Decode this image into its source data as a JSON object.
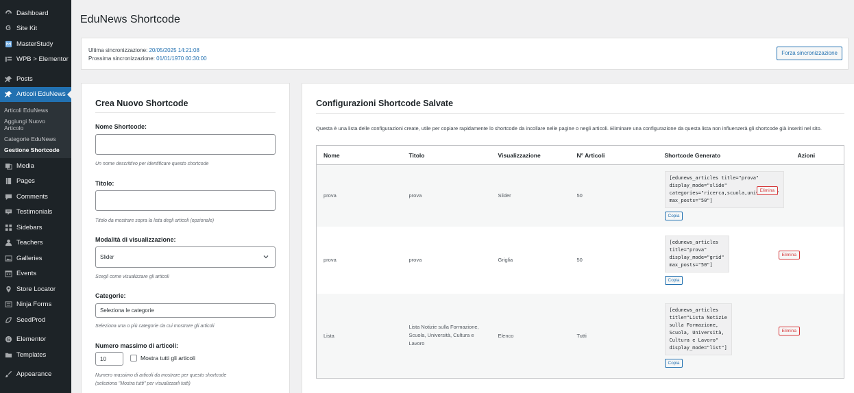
{
  "sidebar": {
    "items_top": [
      {
        "label": "Dashboard",
        "icon": "dashboard-icon"
      },
      {
        "label": "Site Kit",
        "icon": "sitekit-icon"
      },
      {
        "label": "MasterStudy",
        "icon": "masterstudy-icon"
      },
      {
        "label": "WPB > Elementor",
        "icon": "wpb-icon"
      },
      {
        "label": "Posts",
        "icon": "pin-icon"
      },
      {
        "label": "Articoli EduNews",
        "icon": "pin-icon"
      }
    ],
    "submenu": [
      "Articoli EduNews",
      "Aggiungi Nuovo Articolo",
      "Categorie EduNews",
      "Gestione Shortcode"
    ],
    "items_bottom": [
      {
        "label": "Media",
        "icon": "media-icon"
      },
      {
        "label": "Pages",
        "icon": "pages-icon"
      },
      {
        "label": "Comments",
        "icon": "comments-icon"
      },
      {
        "label": "Testimonials",
        "icon": "testimonials-icon"
      },
      {
        "label": "Sidebars",
        "icon": "sidebars-icon"
      },
      {
        "label": "Teachers",
        "icon": "teachers-icon"
      },
      {
        "label": "Galleries",
        "icon": "galleries-icon"
      },
      {
        "label": "Events",
        "icon": "calendar-icon"
      },
      {
        "label": "Store Locator",
        "icon": "location-icon"
      },
      {
        "label": "Ninja Forms",
        "icon": "forms-icon"
      },
      {
        "label": "SeedProd",
        "icon": "seedprod-icon"
      },
      {
        "label": "Elementor",
        "icon": "elementor-icon"
      },
      {
        "label": "Templates",
        "icon": "folder-icon"
      },
      {
        "label": "Appearance",
        "icon": "brush-icon"
      }
    ]
  },
  "page": {
    "title": "EduNews Shortcode"
  },
  "sync": {
    "last_label": "Ultima sincronizzazione: ",
    "last_value": "20/05/2025 14:21:08",
    "next_label": "Prossima sincronizzazione: ",
    "next_value": "01/01/1970 00:30:00",
    "force_button": "Forza sincronizzazione"
  },
  "form": {
    "title": "Crea Nuovo Shortcode",
    "name_label": "Nome Shortcode:",
    "name_value": "",
    "name_help": "Un nome descrittivo per identificare questo shortcode",
    "title_label": "Titolo:",
    "title_value": "",
    "title_help": "Titolo da mostrare sopra la lista degli articoli (opzionale)",
    "mode_label": "Modalità di visualizzazione:",
    "mode_value": "Slider",
    "mode_help": "Scegli come visualizzare gli articoli",
    "cat_label": "Categorie:",
    "cat_placeholder": "Seleziona le categorie",
    "cat_help": "Seleziona una o più categorie da cui mostrare gli articoli",
    "max_label": "Numero massimo di articoli:",
    "max_value": "10",
    "show_all_label": "Mostra tutti gli articoli",
    "max_help_1": "Numero massimo di articoli da mostrare per questo shortcode",
    "max_help_2": "(seleziona \"Mostra tutti\" per visualizzarli tutti)"
  },
  "saved": {
    "title": "Configurazioni Shortcode Salvate",
    "intro": "Questa è una lista delle configurazioni create, utile per copiare rapidamente lo shortcode da incollare nelle pagine o negli articoli. Eliminare una configurazione da questa lista non influenzerà gli shortcode già inseriti nel sito.",
    "headers": [
      "Nome",
      "Titolo",
      "Visualizzazione",
      "N° Articoli",
      "Shortcode Generato",
      "Azioni"
    ],
    "copy_label": "Copia",
    "delete_label": "Elimina",
    "rows": [
      {
        "name": "prova",
        "title": "prova",
        "mode": "Slider",
        "count": "50",
        "code": "[edunews_articles title=\"prova\"\ndisplay_mode=\"slide\"\ncategories=\"ricerca,scuola,universita\"\nmax_posts=\"50\"]"
      },
      {
        "name": "prova",
        "title": "prova",
        "mode": "Griglia",
        "count": "50",
        "code": "[edunews_articles\ntitle=\"prova\"\ndisplay_mode=\"grid\"\nmax_posts=\"50\"]"
      },
      {
        "name": "Lista",
        "title": "Lista Notizie sulla Formazione, Scuola, Università, Cultura e Lavoro",
        "mode": "Elenco",
        "count": "Tutti",
        "code": "[edunews_articles\ntitle=\"Lista Notizie\nsulla Formazione,\nScuola, Università,\nCultura e Lavoro\"\ndisplay_mode=\"list\"]"
      }
    ]
  }
}
